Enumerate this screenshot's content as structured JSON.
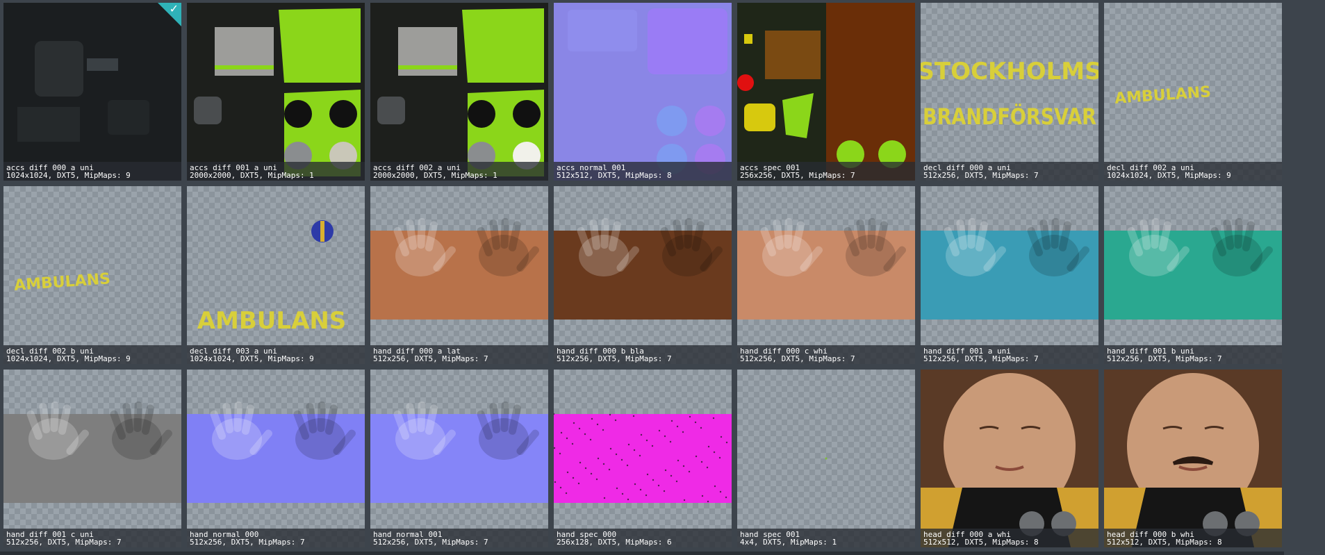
{
  "tiles": [
    {
      "name": "accs_diff_000_a_uni",
      "info": "1024x1024, DXT5, MipMaps: 9",
      "selected": true,
      "art": "accs_dark"
    },
    {
      "name": "accs_diff_001_a_uni",
      "info": "2000x2000, DXT5, MipMaps: 1",
      "art": "accs_green"
    },
    {
      "name": "accs_diff_002_a_uni",
      "info": "2000x2000, DXT5, MipMaps: 1",
      "art": "accs_green2"
    },
    {
      "name": "accs_normal_001",
      "info": "512x512, DXT5, MipMaps: 8",
      "art": "accs_normal"
    },
    {
      "name": "accs_spec_001",
      "info": "256x256, DXT5, MipMaps: 7",
      "art": "accs_spec"
    },
    {
      "name": "decl_diff_000_a_uni",
      "info": "512x256, DXT5, MipMaps: 7",
      "art": "decl_stockholms",
      "text1": "STOCKHOLMS",
      "text2": "BRANDFÖRSVAR"
    },
    {
      "name": "decl_diff_002_a_uni",
      "info": "1024x1024, DXT5, MipMaps: 9",
      "art": "decl_amb_small",
      "text1": "AMBULANS"
    },
    {
      "name": "decl_diff_002_b_uni",
      "info": "1024x1024, DXT5, MipMaps: 9",
      "art": "decl_amb_left",
      "text1": "AMBULANS"
    },
    {
      "name": "decl_diff_003_a_uni",
      "info": "1024x1024, DXT5, MipMaps: 9",
      "art": "decl_amb_big",
      "text1": "AMBULANS"
    },
    {
      "name": "hand_diff_000_a_lat",
      "info": "512x256, DXT5, MipMaps: 7",
      "art": "hand",
      "color": "#b8724a"
    },
    {
      "name": "hand_diff_000_b_bla",
      "info": "512x256, DXT5, MipMaps: 7",
      "art": "hand",
      "color": "#6a3a1e"
    },
    {
      "name": "hand_diff_000_c_whi",
      "info": "512x256, DXT5, MipMaps: 7",
      "art": "hand",
      "color": "#c98a68"
    },
    {
      "name": "hand_diff_001_a_uni",
      "info": "512x256, DXT5, MipMaps: 7",
      "art": "hand",
      "color": "#3a9cb5"
    },
    {
      "name": "hand_diff_001_b_uni",
      "info": "512x256, DXT5, MipMaps: 7",
      "art": "hand",
      "color": "#2aa890"
    },
    {
      "name": "hand_diff_001_c_uni",
      "info": "512x256, DXT5, MipMaps: 7",
      "art": "hand",
      "color": "#7e7e7e"
    },
    {
      "name": "hand_normal_000",
      "info": "512x256, DXT5, MipMaps: 7",
      "art": "hand",
      "color": "#8080f5"
    },
    {
      "name": "hand_normal_001",
      "info": "512x256, DXT5, MipMaps: 7",
      "art": "hand",
      "color": "#8585f8"
    },
    {
      "name": "hand_spec_000",
      "info": "256x128, DXT5, MipMaps: 6",
      "art": "spec_pink"
    },
    {
      "name": "hand_spec_001",
      "info": "4x4, DXT5, MipMaps: 1",
      "art": "empty"
    },
    {
      "name": "head_diff_000_a_whi",
      "info": "512x512, DXT5, MipMaps: 8",
      "art": "head"
    },
    {
      "name": "head_diff_000_b_whi",
      "info": "512x512, DXT5, MipMaps: 8",
      "art": "head_mustache"
    }
  ],
  "colors": {
    "selection": "#2fb2b8",
    "decal_yellow": "#d8cf3a",
    "lime": "#8bd61a"
  }
}
